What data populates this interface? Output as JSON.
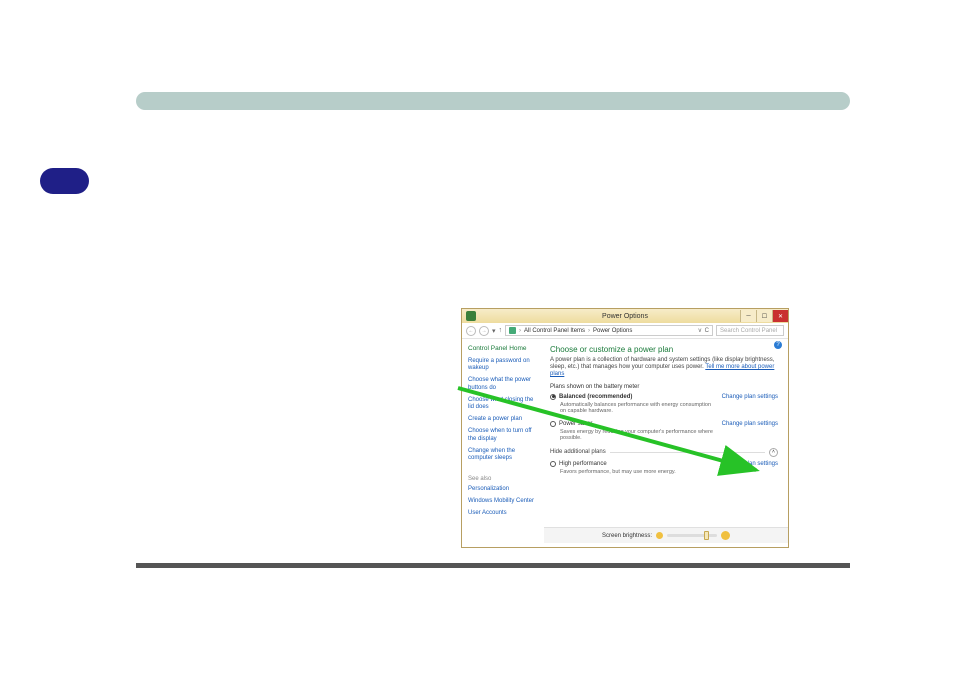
{
  "window": {
    "title": "Power Options",
    "breadcrumb_part1": "All Control Panel Items",
    "breadcrumb_part2": "Power Options",
    "search_placeholder": "Search Control Panel"
  },
  "sidebar": {
    "home": "Control Panel Home",
    "links": [
      "Require a password on wakeup",
      "Choose what the power buttons do",
      "Choose what closing the lid does",
      "Create a power plan",
      "Choose when to turn off the display",
      "Change when the computer sleeps"
    ],
    "seealso_label": "See also",
    "seealso": [
      "Personalization",
      "Windows Mobility Center",
      "User Accounts"
    ]
  },
  "main": {
    "heading": "Choose or customize a power plan",
    "desc_prefix": "A power plan is a collection of hardware and system settings (like display brightness, sleep, etc.) that manages how your computer uses power. ",
    "desc_link": "Tell me more about power plans",
    "section_label": "Plans shown on the battery meter",
    "plan_balanced": "Balanced (recommended)",
    "plan_balanced_sub": "Automatically balances performance with energy consumption on capable hardware.",
    "plan_powersaver": "Power saver",
    "plan_powersaver_sub": "Saves energy by reducing your computer's performance where possible.",
    "change_settings": "Change plan settings",
    "hide_label": "Hide additional plans",
    "plan_highperf": "High performance",
    "plan_highperf_sub": "Favors performance, but may use more energy.",
    "brightness_label": "Screen brightness:"
  }
}
